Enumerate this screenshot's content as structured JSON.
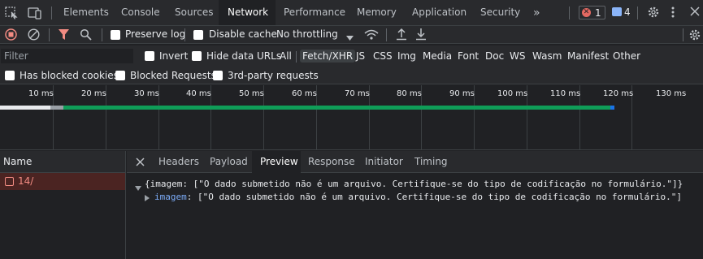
{
  "tabbar": {
    "tabs": [
      "Elements",
      "Console",
      "Sources",
      "Network",
      "Performance",
      "Memory",
      "Application",
      "Security"
    ],
    "active_tab": "Network",
    "error_count": "1",
    "message_count": "4"
  },
  "toolbar": {
    "preserve_log": "Preserve log",
    "disable_cache": "Disable cache",
    "throttling": "No throttling"
  },
  "filter": {
    "placeholder": "Filter",
    "invert": "Invert",
    "hide_data_urls": "Hide data URLs",
    "types": [
      "All",
      "Fetch/XHR",
      "JS",
      "CSS",
      "Img",
      "Media",
      "Font",
      "Doc",
      "WS",
      "Wasm",
      "Manifest",
      "Other"
    ],
    "active_type": "Fetch/XHR",
    "has_blocked_cookies": "Has blocked cookies",
    "blocked_requests": "Blocked Requests",
    "third_party": "3rd-party requests"
  },
  "timeline": {
    "ticks": [
      "10 ms",
      "20 ms",
      "30 ms",
      "40 ms",
      "50 ms",
      "60 ms",
      "70 ms",
      "80 ms",
      "90 ms",
      "100 ms",
      "110 ms",
      "120 ms",
      "130 ms"
    ]
  },
  "requests": {
    "header": "Name",
    "items": [
      {
        "name": "14/"
      }
    ]
  },
  "detail": {
    "tabs": [
      "Headers",
      "Payload",
      "Preview",
      "Response",
      "Initiator",
      "Timing"
    ],
    "active_tab": "Preview",
    "preview_line1": "{imagem: [\"O dado submetido não é um arquivo. Certifique-se do tipo de codificação no formulário.\"]}",
    "preview_key": "imagem",
    "preview_line2_value": ": [\"O dado submetido não é um arquivo. Certifique-se do tipo de codificação no formulário.\"]"
  },
  "colors": {
    "background": "#202124",
    "toolbar": "#292a2d",
    "error_red": "#f28b82",
    "accent_blue": "#8ab4f8",
    "timeline_green": "#0f9d58"
  }
}
